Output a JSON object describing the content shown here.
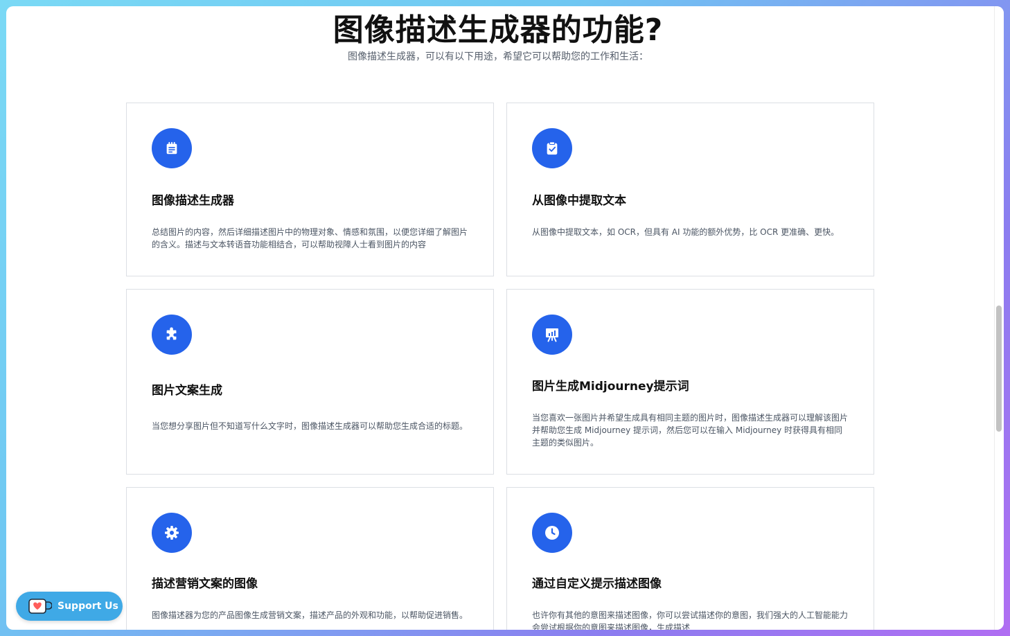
{
  "header": {
    "title": "图像描述生成器的功能?",
    "subtitle": "图像描述生成器，可以有以下用途，希望它可以帮助您的工作和生活："
  },
  "features": [
    {
      "icon": "notepad-icon",
      "title": "图像描述生成器",
      "description": "总结图片的内容，然后详细描述图片中的物理对象、情感和氛围，以便您详细了解图片的含义。描述与文本转语音功能相结合，可以帮助视障人士看到图片的内容"
    },
    {
      "icon": "clipboard-check-icon",
      "title": "从图像中提取文本",
      "description": "从图像中提取文本，如 OCR，但具有 AI 功能的额外优势，比 OCR 更准确、更快。"
    },
    {
      "icon": "puzzle-icon",
      "title": "图片文案生成",
      "description": "当您想分享图片但不知道写什么文字时，图像描述生成器可以帮助您生成合适的标题。"
    },
    {
      "icon": "presentation-chart-icon",
      "title": "图片生成Midjourney提示词",
      "description": "当您喜欢一张图片并希望生成具有相同主题的图片时，图像描述生成器可以理解该图片并帮助您生成 Midjourney 提示词，然后您可以在输入 Midjourney 时获得具有相同主题的类似图片。"
    },
    {
      "icon": "gear-icon",
      "title": "描述营销文案的图像",
      "description": "图像描述器为您的产品图像生成营销文案，描述产品的外观和功能，以帮助促进销售。"
    },
    {
      "icon": "clock-icon",
      "title": "通过自定义提示描述图像",
      "description": "也许你有其他的意图来描述图像，你可以尝试描述你的意图，我们强大的人工智能能力会尝试根据你的意图来描述图像，生成描述"
    }
  ],
  "support": {
    "label": "Support Us",
    "icon": "kofi-cup-icon"
  },
  "colors": {
    "accent": "#2563eb",
    "support": "#3fa9e6"
  }
}
